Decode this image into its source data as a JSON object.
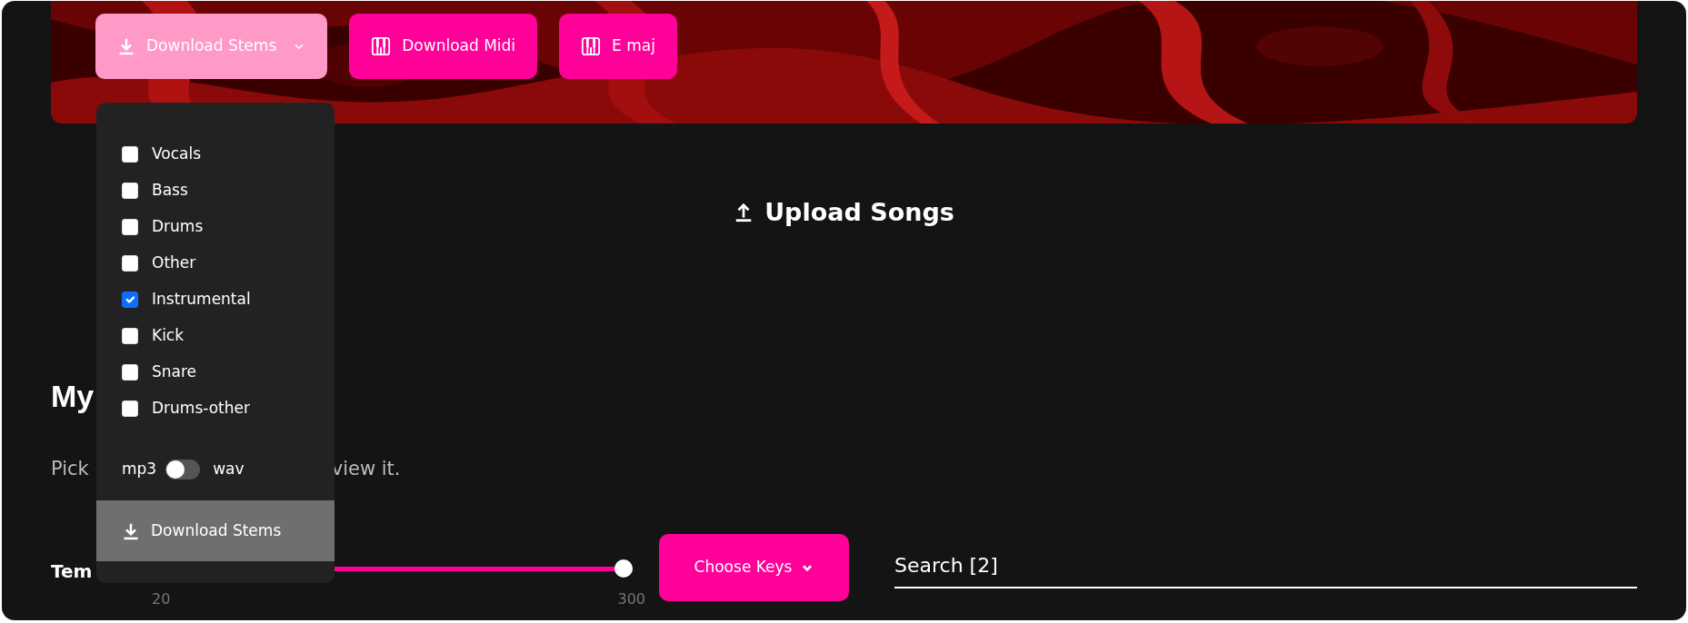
{
  "banner": {
    "kind": "picture",
    "buttons": [
      {
        "label": "Download Stems",
        "kind": "dropdown",
        "expanded": true
      },
      {
        "label": "Download Midi",
        "kind": "piano"
      },
      {
        "label": "E maj",
        "kind": "piano"
      }
    ]
  },
  "stems_menu": {
    "options": [
      {
        "label": "Vocals",
        "checked": false
      },
      {
        "label": "Bass",
        "checked": false
      },
      {
        "label": "Drums",
        "checked": false
      },
      {
        "label": "Other",
        "checked": false
      },
      {
        "label": "Instrumental",
        "checked": true
      },
      {
        "label": "Kick",
        "checked": false
      },
      {
        "label": "Snare",
        "checked": false
      },
      {
        "label": "Drums-other",
        "checked": false
      }
    ],
    "format": {
      "left": "mp3",
      "right": "wav",
      "on": false
    },
    "action": "Download Stems"
  },
  "upload": "Upload Songs",
  "heading": "My",
  "intro": [
    "Pick",
    "view it."
  ],
  "tempo": {
    "label": "Tem",
    "level": 1,
    "min": "20",
    "max": "300"
  },
  "keys_button": "Choose Keys",
  "search": {
    "placeholder": "Search [2]"
  }
}
